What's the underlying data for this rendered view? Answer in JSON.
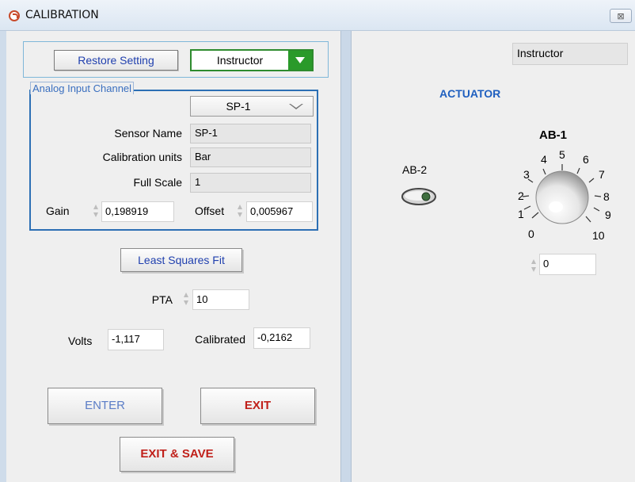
{
  "window": {
    "title": "CALIBRATION",
    "close_glyph": "⊠"
  },
  "top": {
    "restore_label": "Restore Setting",
    "user_select_value": "Instructor"
  },
  "channel": {
    "group_label": "Analog Input Channel",
    "selected": "SP-1",
    "sensor_name_label": "Sensor Name",
    "sensor_name_value": "SP-1",
    "units_label": "Calibration units",
    "units_value": "Bar",
    "full_scale_label": "Full Scale",
    "full_scale_value": "1",
    "gain_label": "Gain",
    "gain_value": "0,198919",
    "offset_label": "Offset",
    "offset_value": "0,005967"
  },
  "fit": {
    "lsq_label": "Least Squares  Fit",
    "pta_label": "PTA",
    "pta_value": "10"
  },
  "readings": {
    "volts_label": "Volts",
    "volts_value": "-1,117",
    "calibrated_label": "Calibrated",
    "calibrated_value": "-0,2162"
  },
  "buttons": {
    "enter": "ENTER",
    "exit": "EXIT",
    "exit_save": "EXIT & SAVE"
  },
  "right": {
    "user_indicator": "Instructor",
    "actuator_title": "ACTUATOR",
    "ab2_label": "AB-2",
    "ab1_label": "AB-1",
    "knob_ticks": [
      "0",
      "1",
      "2",
      "3",
      "4",
      "5",
      "6",
      "7",
      "8",
      "9",
      "10"
    ],
    "knob_value": "0"
  },
  "colors": {
    "accent_blue": "#1f5fbf",
    "exit_red": "#c0201a",
    "select_green": "#2a9a2a"
  }
}
